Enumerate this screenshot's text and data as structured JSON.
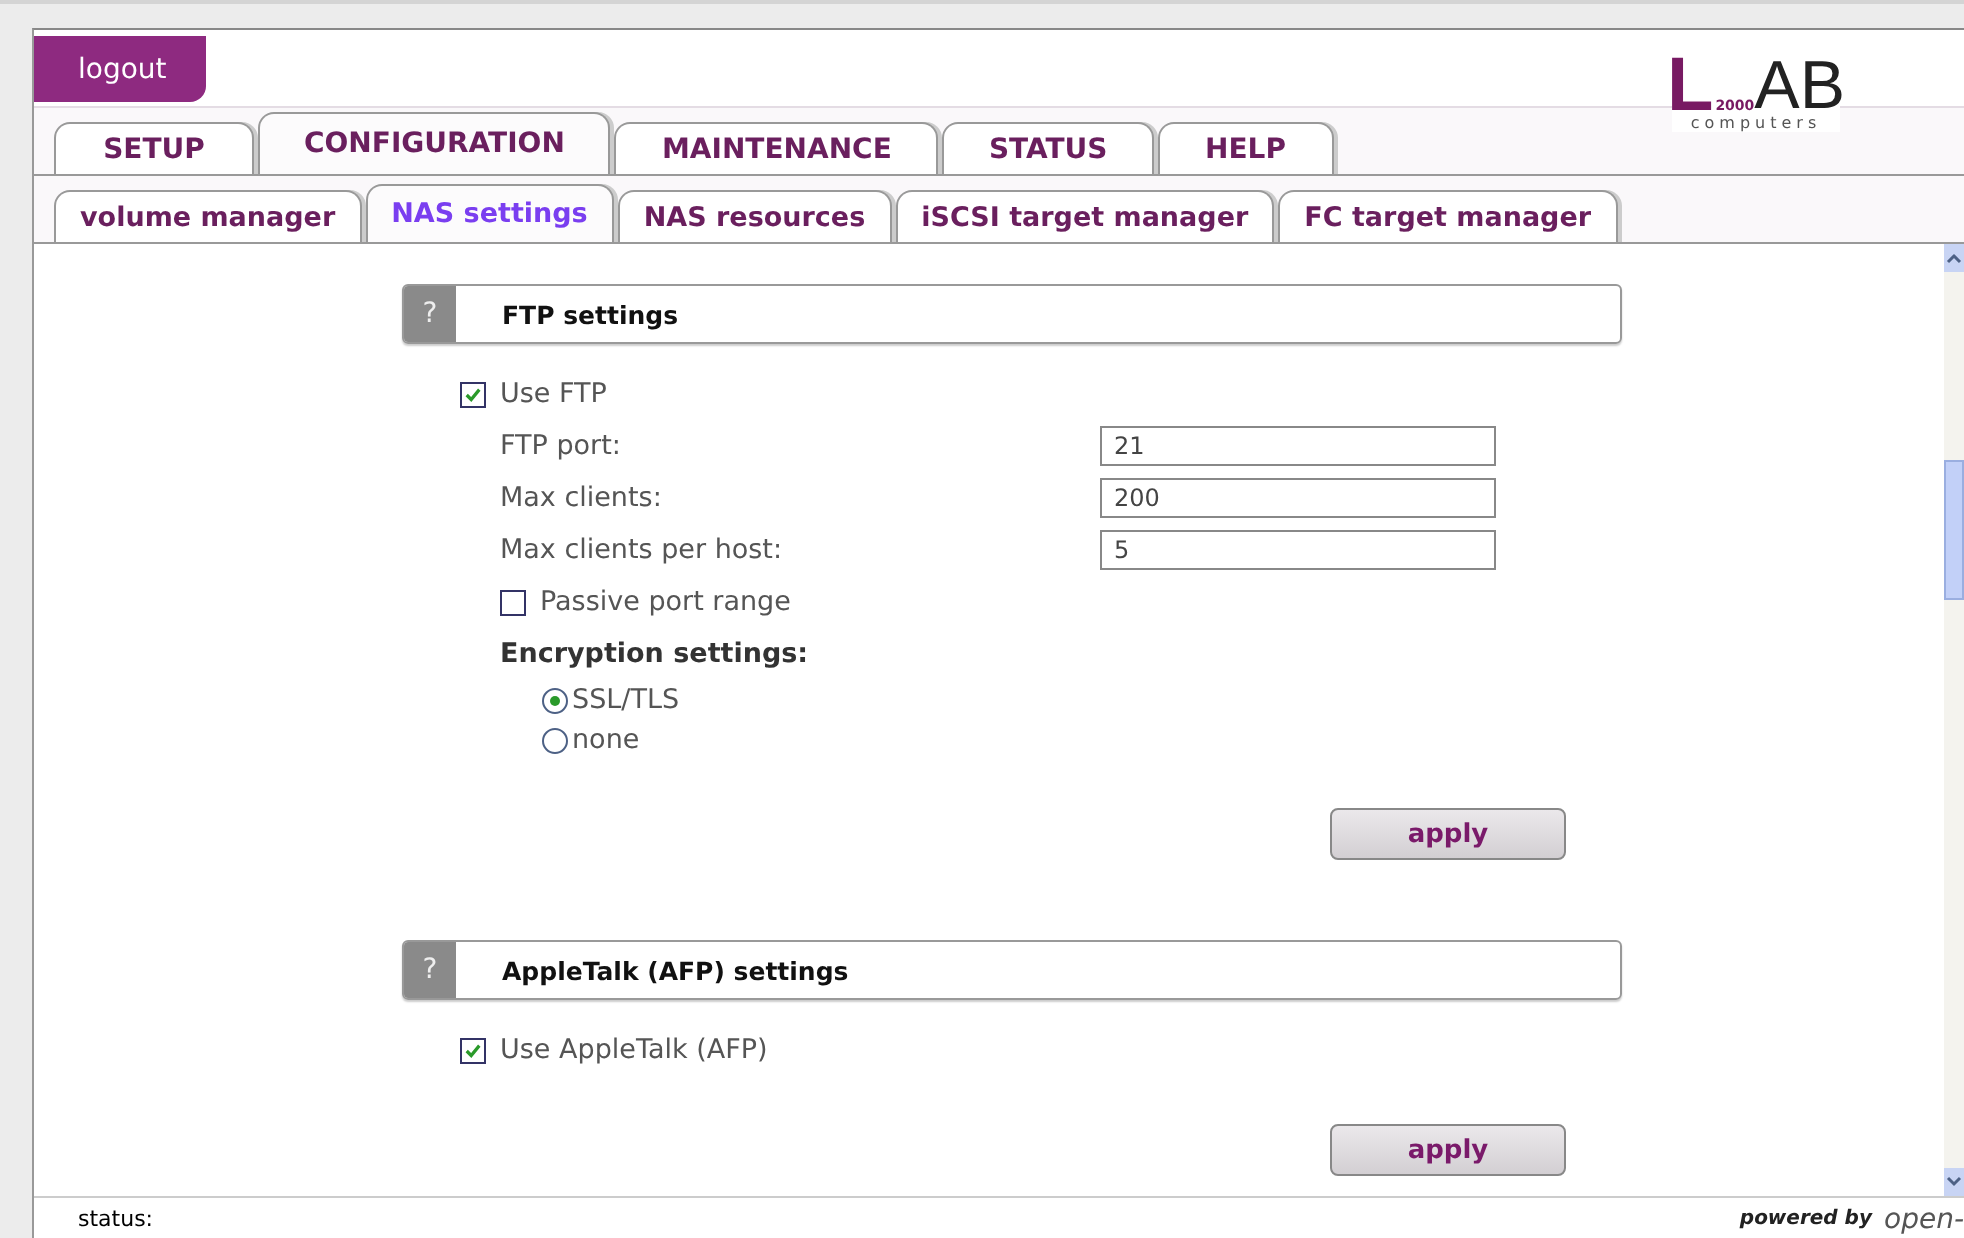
{
  "header": {
    "logout": "logout",
    "logo": {
      "initial": "L",
      "year": "2000",
      "rest": "AB",
      "tagline": "computers"
    }
  },
  "main_tabs": [
    {
      "label": "SETUP",
      "selected": false
    },
    {
      "label": "CONFIGURATION",
      "selected": true
    },
    {
      "label": "MAINTENANCE",
      "selected": false
    },
    {
      "label": "STATUS",
      "selected": false
    },
    {
      "label": "HELP",
      "selected": false
    }
  ],
  "sub_tabs": [
    {
      "label": "volume manager",
      "selected": false
    },
    {
      "label": "NAS settings",
      "selected": true
    },
    {
      "label": "NAS resources",
      "selected": false
    },
    {
      "label": "iSCSI target manager",
      "selected": false
    },
    {
      "label": "FC target manager",
      "selected": false
    }
  ],
  "sections": [
    {
      "help": "?",
      "title": "FTP settings",
      "items": [
        {
          "kind": "checkbox",
          "label": "Use FTP",
          "checked": true
        },
        {
          "kind": "field",
          "label": "FTP port:",
          "value": "21"
        },
        {
          "kind": "field",
          "label": "Max clients:",
          "value": "200"
        },
        {
          "kind": "field",
          "label": "Max clients per host:",
          "value": "5"
        },
        {
          "kind": "sub_checkbox",
          "label": "Passive port range",
          "checked": false
        },
        {
          "kind": "heading",
          "label": "Encryption settings:"
        },
        {
          "kind": "radio",
          "label": "SSL/TLS",
          "selected": true
        },
        {
          "kind": "radio",
          "label": "none",
          "selected": false
        }
      ],
      "button": "apply"
    },
    {
      "help": "?",
      "title": "AppleTalk (AFP) settings",
      "items": [
        {
          "kind": "checkbox",
          "label": "Use AppleTalk (AFP)",
          "checked": true
        }
      ],
      "button": "apply"
    }
  ],
  "status_bar": {
    "label": "status:",
    "powered_by": "powered by",
    "brand": "open-"
  }
}
